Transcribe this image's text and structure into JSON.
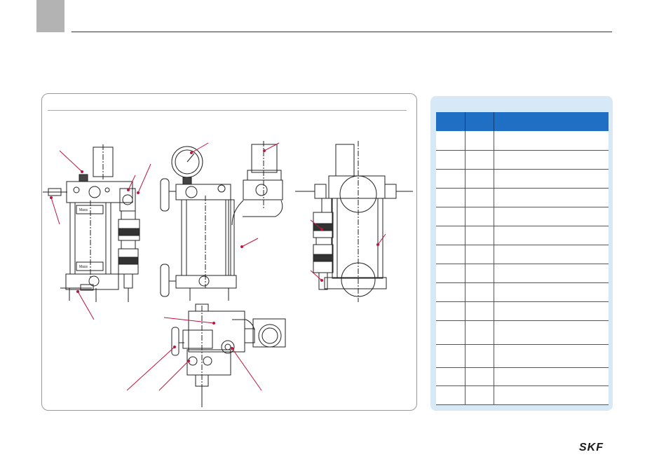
{
  "brand": {
    "logo_text": "SKF",
    "color": "#1a1a1a"
  },
  "colors": {
    "accent": "#1f6fc5",
    "panel": "#d7e8f7",
    "leader": "#c0143c"
  },
  "drawing": {
    "nameplate_text_1": "Mass",
    "nameplate_text_2": "Mass"
  },
  "parts_table": {
    "header": [
      "",
      "",
      ""
    ],
    "rows": [
      [
        "",
        "",
        ""
      ],
      [
        "",
        "",
        ""
      ],
      [
        "",
        "",
        ""
      ],
      [
        "",
        "",
        ""
      ],
      [
        "",
        "",
        ""
      ],
      [
        "",
        "",
        ""
      ],
      [
        "",
        "",
        ""
      ],
      [
        "",
        "",
        ""
      ],
      [
        "",
        "",
        ""
      ],
      [
        "",
        "",
        ""
      ],
      [
        "",
        "",
        ""
      ],
      [
        "",
        "",
        ""
      ],
      [
        "",
        "",
        ""
      ],
      [
        "",
        "",
        ""
      ]
    ]
  }
}
